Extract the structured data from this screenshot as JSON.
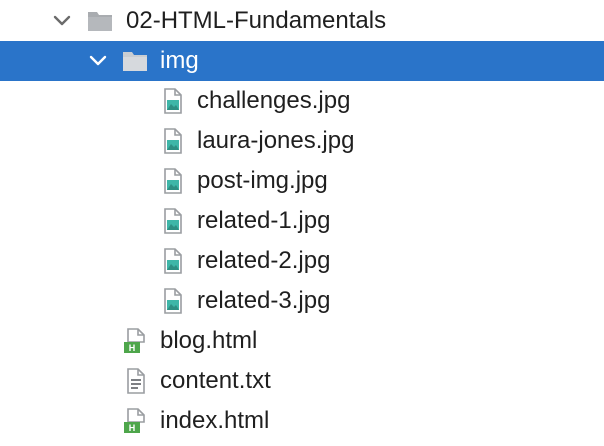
{
  "tree": {
    "root_folder": {
      "label": "02-HTML-Fundamentals",
      "expanded": true,
      "icon": "folder-icon"
    },
    "img_folder": {
      "label": "img",
      "expanded": true,
      "selected": true,
      "icon": "folder-icon"
    },
    "images": [
      {
        "label": "challenges.jpg",
        "icon": "image-file-icon"
      },
      {
        "label": "laura-jones.jpg",
        "icon": "image-file-icon"
      },
      {
        "label": "post-img.jpg",
        "icon": "image-file-icon"
      },
      {
        "label": "related-1.jpg",
        "icon": "image-file-icon"
      },
      {
        "label": "related-2.jpg",
        "icon": "image-file-icon"
      },
      {
        "label": "related-3.jpg",
        "icon": "image-file-icon"
      }
    ],
    "files": [
      {
        "label": "blog.html",
        "icon": "html-file-icon",
        "badge": "H"
      },
      {
        "label": "content.txt",
        "icon": "text-file-icon"
      },
      {
        "label": "index.html",
        "icon": "html-file-icon",
        "badge": "H"
      }
    ]
  },
  "colors": {
    "selection": "#2a74c9",
    "folder_gray": "#a9acb0",
    "html_badge": "#4ea64b",
    "image_teal": "#3fb6a8"
  }
}
